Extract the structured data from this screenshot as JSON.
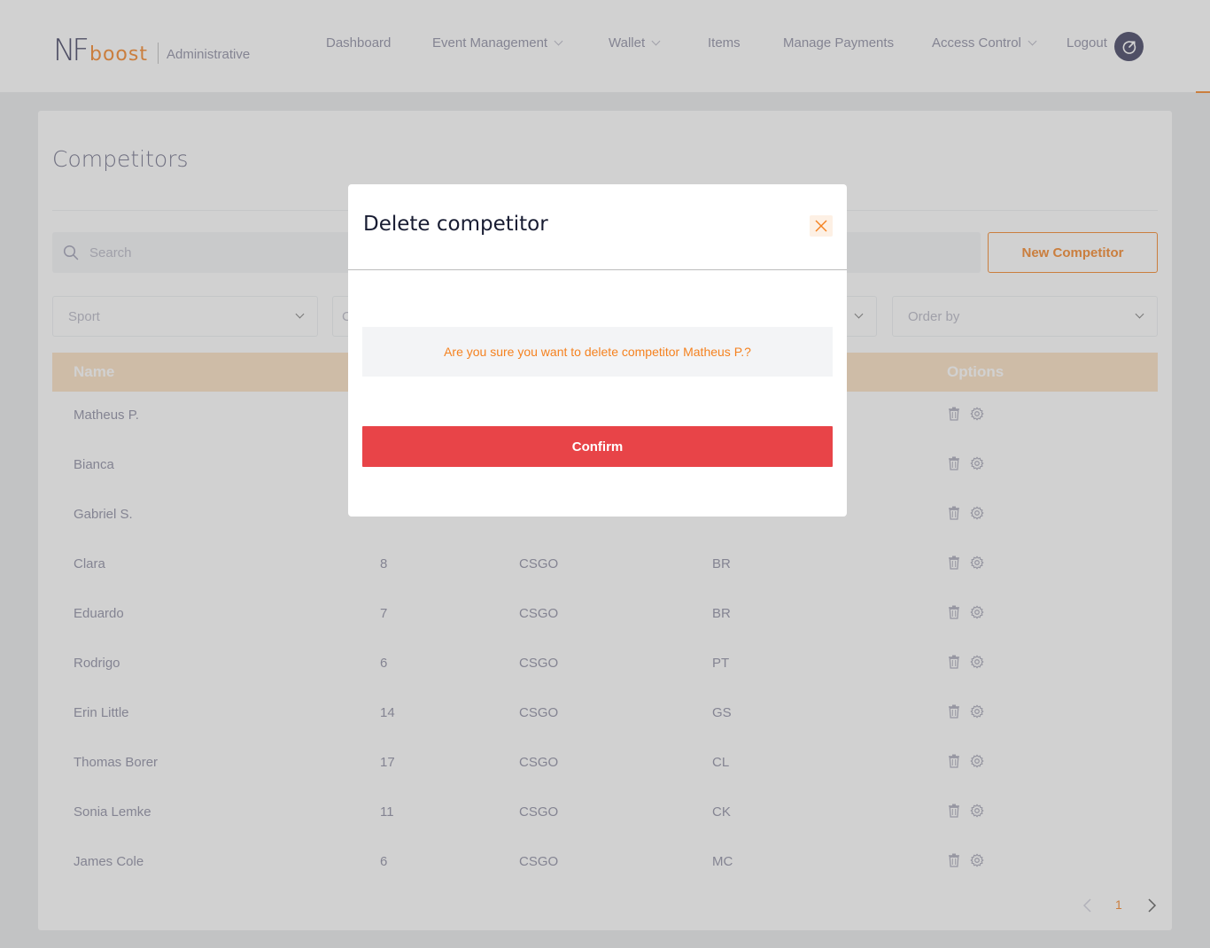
{
  "brand": {
    "logo_nf": "NF",
    "logo_boost": "boost",
    "subtitle": "Administrative"
  },
  "nav": {
    "items": [
      {
        "label": "Dashboard",
        "has_dropdown": false
      },
      {
        "label": "Event Management",
        "has_dropdown": true
      },
      {
        "label": "Wallet",
        "has_dropdown": true
      },
      {
        "label": "Items",
        "has_dropdown": false
      },
      {
        "label": "Manage Payments",
        "has_dropdown": false
      },
      {
        "label": "Access Control",
        "has_dropdown": true
      }
    ],
    "logout_label": "Logout"
  },
  "page": {
    "title": "Competitors",
    "search_placeholder": "Search",
    "new_button_label": "New Competitor",
    "filters": {
      "sport": "Sport",
      "second": "C",
      "order_by": "Order by"
    },
    "table": {
      "columns": {
        "name": "Name",
        "options": "Options"
      },
      "rows": [
        {
          "name": "Matheus P.",
          "num": "",
          "game": "",
          "country": ""
        },
        {
          "name": "Bianca",
          "num": "",
          "game": "",
          "country": ""
        },
        {
          "name": "Gabriel S.",
          "num": "",
          "game": "",
          "country": ""
        },
        {
          "name": "Clara",
          "num": "8",
          "game": "CSGO",
          "country": "BR"
        },
        {
          "name": "Eduardo",
          "num": "7",
          "game": "CSGO",
          "country": "BR"
        },
        {
          "name": "Rodrigo",
          "num": "6",
          "game": "CSGO",
          "country": "PT"
        },
        {
          "name": "Erin Little",
          "num": "14",
          "game": "CSGO",
          "country": "GS"
        },
        {
          "name": "Thomas Borer",
          "num": "17",
          "game": "CSGO",
          "country": "CL"
        },
        {
          "name": "Sonia Lemke",
          "num": "11",
          "game": "CSGO",
          "country": "CK"
        },
        {
          "name": "James Cole",
          "num": "6",
          "game": "CSGO",
          "country": "MC"
        }
      ]
    },
    "pagination": {
      "current_page": "1"
    }
  },
  "modal": {
    "title": "Delete competitor",
    "message": "Are you sure you want to delete competitor Matheus P.?",
    "confirm_label": "Confirm"
  },
  "icons": {
    "search": "search-icon",
    "close": "close-icon",
    "delete": "trash-icon",
    "settings": "gear-icon",
    "logout": "logout-icon",
    "prev": "chevron-left-icon",
    "next": "chevron-right-icon"
  },
  "colors": {
    "accent": "#f58220",
    "table_header": "#fbdfc0",
    "danger": "#e84448",
    "nav_text": "#8a8aa0"
  }
}
